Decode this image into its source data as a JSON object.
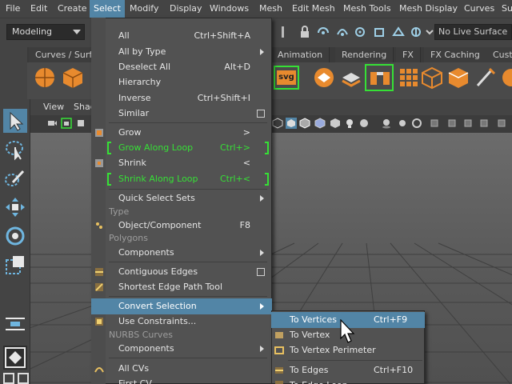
{
  "menubar": {
    "items": [
      "File",
      "Edit",
      "Create",
      "Select",
      "Modify",
      "Display",
      "Windows",
      "Mesh",
      "Edit Mesh",
      "Mesh Tools",
      "Mesh Display",
      "Curves",
      "Su"
    ],
    "active_index": 3
  },
  "status_line": {
    "mode": "Modeling",
    "live_surface": "No Live Surface"
  },
  "shelf": {
    "tabs": [
      "Curves / Surfa",
      "Animation",
      "Rendering",
      "FX",
      "FX Caching",
      "Cust"
    ],
    "svg_label": "svg"
  },
  "viewport": {
    "menu": [
      "View",
      "Shad"
    ]
  },
  "select_menu": {
    "items": {
      "all": {
        "label": "All",
        "shortcut": "Ctrl+Shift+A"
      },
      "all_by_type": {
        "label": "All by Type"
      },
      "deselect_all": {
        "label": "Deselect All",
        "shortcut": "Alt+D"
      },
      "hierarchy": {
        "label": "Hierarchy"
      },
      "inverse": {
        "label": "Inverse",
        "shortcut": "Ctrl+Shift+I"
      },
      "similar": {
        "label": "Similar"
      },
      "grow": {
        "label": "Grow",
        "shortcut": ">"
      },
      "grow_along_loop": {
        "label": "Grow Along Loop",
        "shortcut": "Ctrl+>"
      },
      "shrink": {
        "label": "Shrink",
        "shortcut": "<"
      },
      "shrink_along_loop": {
        "label": "Shrink Along Loop",
        "shortcut": "Ctrl+<"
      },
      "quick_select_sets": {
        "label": "Quick Select Sets"
      },
      "object_component": {
        "label": "Object/Component",
        "shortcut": "F8"
      },
      "components_poly": {
        "label": "Components"
      },
      "contiguous_edges": {
        "label": "Contiguous Edges"
      },
      "shortest_edge_path": {
        "label": "Shortest Edge Path Tool"
      },
      "convert_selection": {
        "label": "Convert Selection"
      },
      "use_constraints": {
        "label": "Use Constraints..."
      },
      "components_nurbs": {
        "label": "Components"
      },
      "all_cvs": {
        "label": "All CVs"
      },
      "first_cv": {
        "label": "First CV"
      }
    },
    "sections": {
      "type": "Type",
      "polygons": "Polygons",
      "nurbs_curves": "NURBS Curves"
    }
  },
  "convert_submenu": {
    "items": [
      {
        "label": "To Vertices",
        "shortcut": "Ctrl+F9"
      },
      {
        "label": "To Vertex Faces",
        "shortcut": ""
      },
      {
        "label": "To Vertex Perimeter",
        "shortcut": ""
      },
      {
        "label": "To Edges",
        "shortcut": "Ctrl+F10"
      },
      {
        "label": "To Edge Loop",
        "shortcut": ""
      }
    ]
  },
  "colors": {
    "highlight": "#5285a6",
    "loop_green": "#36e036",
    "menu_bg": "#525252"
  }
}
